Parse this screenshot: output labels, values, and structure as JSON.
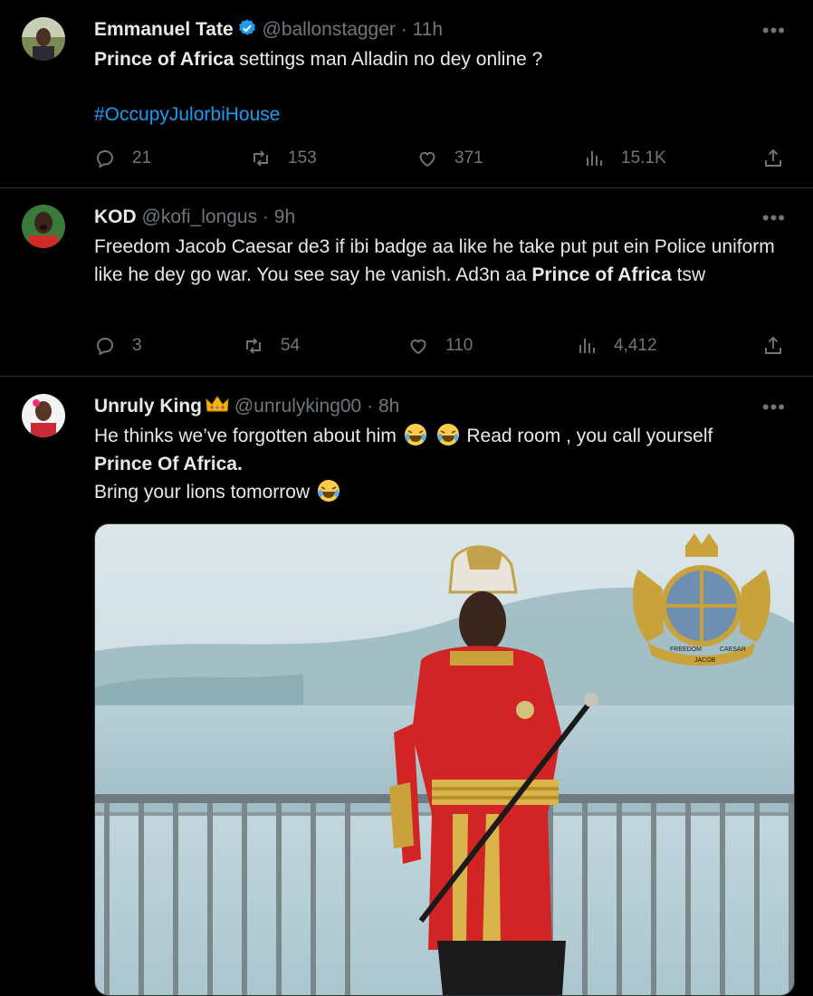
{
  "tweets": [
    {
      "name": "Emmanuel Tate",
      "handle": "@ballonstagger",
      "time": "11h",
      "text_bold": "Prince of Africa",
      "text_rest": " settings man Alladin no dey online ?",
      "hashtag": "#OccupyJulorbiHouse",
      "replies": "21",
      "retweets": "153",
      "likes": "371",
      "views": "15.1K"
    },
    {
      "name": "KOD",
      "handle": "@kofi_longus",
      "time": "9h",
      "text_pre": "Freedom Jacob Caesar de3 if ibi badge aa like he take put put ein Police uniform like he dey go war. You see say he vanish. Ad3n aa ",
      "text_bold": "Prince of Africa",
      "text_post": " tsw",
      "replies": "3",
      "retweets": "54",
      "likes": "110",
      "views": "4,412"
    },
    {
      "name": "Unruly King",
      "handle": "@unrulyking00",
      "time": "8h",
      "line1": "He thinks we’ve forgotten about him",
      "line1_post": " Read room , you call yourself",
      "line2_bold": "Prince Of Africa.",
      "line3": "Bring your lions tomorrow",
      "emblem_text": [
        "FREEDOM",
        "JACOB",
        "CAESAR"
      ]
    }
  ],
  "separator": "·",
  "more_label": "•••",
  "colors": {
    "accent": "#1d9bf0",
    "muted": "#71767b",
    "text": "#e7e9ea",
    "background": "#000000"
  }
}
